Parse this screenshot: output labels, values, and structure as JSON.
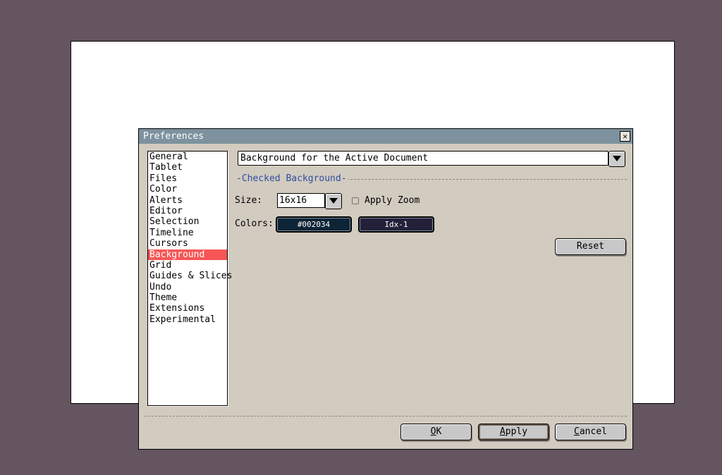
{
  "dialog": {
    "title": "Preferences",
    "close_icon": "close-x-icon"
  },
  "sidebar": {
    "items": [
      {
        "label": "General",
        "selected": false
      },
      {
        "label": "Tablet",
        "selected": false
      },
      {
        "label": "Files",
        "selected": false
      },
      {
        "label": "Color",
        "selected": false
      },
      {
        "label": "Alerts",
        "selected": false
      },
      {
        "label": "Editor",
        "selected": false
      },
      {
        "label": "Selection",
        "selected": false
      },
      {
        "label": "Timeline",
        "selected": false
      },
      {
        "label": "Cursors",
        "selected": false
      },
      {
        "label": "Background",
        "selected": true
      },
      {
        "label": "Grid",
        "selected": false
      },
      {
        "label": "Guides & Slices",
        "selected": false
      },
      {
        "label": "Undo",
        "selected": false
      },
      {
        "label": "Theme",
        "selected": false
      },
      {
        "label": "Extensions",
        "selected": false
      },
      {
        "label": "Experimental",
        "selected": false
      }
    ]
  },
  "background": {
    "target_value": "Background for the Active Document",
    "section_label": "Checked Background",
    "size_label": "Size:",
    "size_value": "16x16",
    "apply_zoom_label": "Apply Zoom",
    "apply_zoom_checked": false,
    "colors_label": "Colors:",
    "color1": {
      "label": "#002034",
      "color": "#0d2436"
    },
    "color2": {
      "label": "Idx-1",
      "color": "#24203a"
    },
    "reset_label": "Reset"
  },
  "footer": {
    "ok_mnemonic": "O",
    "ok_rest": "K",
    "apply_mnemonic": "A",
    "apply_rest": "pply",
    "cancel_mnemonic": "C",
    "cancel_rest": "ancel"
  }
}
